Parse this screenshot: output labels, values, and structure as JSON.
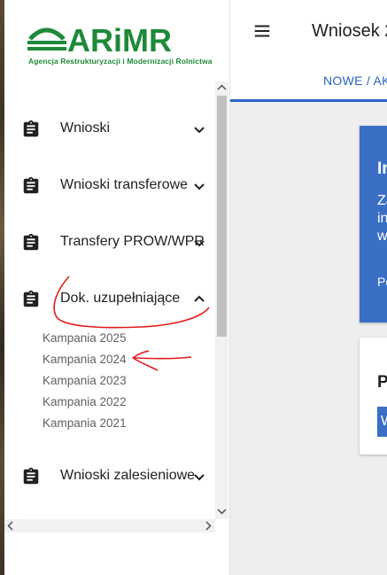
{
  "logo": {
    "wordmark": "ARiMR",
    "subtitle": "Agencja Restrukturyzacji i Modernizacji Rolnictwa",
    "color": "#1d8a3a"
  },
  "sidebar": {
    "items": [
      {
        "label": "Wnioski",
        "icon": "clipboard-icon",
        "expanded": false
      },
      {
        "label": "Wnioski transferowe",
        "icon": "clipboard-icon",
        "expanded": false
      },
      {
        "label": "Transfery PROW/WPR",
        "icon": "clipboard-icon",
        "expanded": false
      },
      {
        "label": "Dok. uzupełniające",
        "icon": "clipboard-icon",
        "expanded": true,
        "children": [
          "Kampania 2025",
          "Kampania 2024",
          "Kampania 2023",
          "Kampania 2022",
          "Kampania 2021"
        ]
      },
      {
        "label": "Wnioski zalesieniowe",
        "icon": "clipboard-icon",
        "expanded": false
      }
    ]
  },
  "header": {
    "menu_icon": "hamburger-icon",
    "title": "Wniosek 2"
  },
  "tabs": [
    {
      "label": "NOWE / AK",
      "active": true
    }
  ],
  "cards": {
    "info": {
      "lines": [
        "In",
        "Za",
        "in",
        "w",
        "Po"
      ]
    },
    "second": {
      "heading": "P",
      "button_label": "W"
    }
  },
  "colors": {
    "accent": "#2962c9",
    "card_blue": "#3a6fc4",
    "annotation": "#e11b1b"
  }
}
